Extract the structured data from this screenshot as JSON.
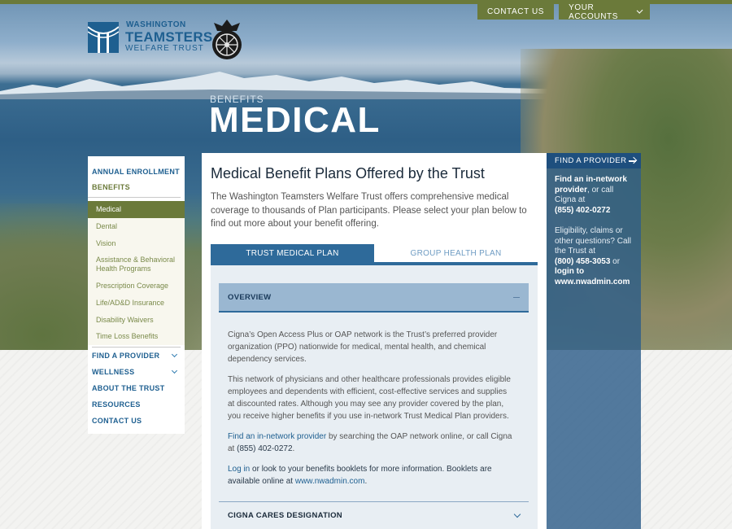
{
  "topnav": {
    "contact": "CONTACT US",
    "accounts": "YOUR ACCOUNTS"
  },
  "logo": {
    "line1": "WASHINGTON",
    "line2": "TEAMSTERS",
    "line3": "WELFARE TRUST"
  },
  "page": {
    "breadcrumb": "BENEFITS",
    "title": "MEDICAL"
  },
  "sidebar": {
    "annual": "ANNUAL ENROLLMENT",
    "benefits": "BENEFITS",
    "sub_items": [
      "Medical",
      "Dental",
      "Vision",
      "Assistance & Behavioral Health Programs",
      "Prescription Coverage",
      "Life/AD&D Insurance",
      "Disability Waivers",
      "Time Loss Benefits"
    ],
    "links": [
      "FIND A PROVIDER",
      "WELLNESS",
      "ABOUT THE TRUST",
      "RESOURCES",
      "CONTACT US"
    ]
  },
  "main": {
    "heading": "Medical Benefit Plans Offered by the Trust",
    "intro": "The Washington Teamsters Welfare Trust offers comprehensive medical coverage to thousands of Plan participants. Please select your plan below to find out more about your benefit offering.",
    "tabs": [
      "TRUST MEDICAL PLAN",
      "GROUP HEALTH PLAN"
    ],
    "accordion": {
      "overview_label": "OVERVIEW",
      "p1": "Cigna’s Open Access Plus or OAP network is the Trust’s preferred provider organization (PPO) nationwide for medical, mental health, and chemical dependency services.",
      "p2": "This network of physicians and other healthcare professionals provides eligible employees and dependents with efficient, cost-effective services and supplies at discounted rates. Although you may see any provider covered by the plan, you receive higher benefits if you use in-network Trust Medical Plan providers.",
      "p3_link": "Find an in-network provider",
      "p3_rest": " by searching the OAP network online, or call Cigna at ",
      "p3_phone": "(855) 402-0272",
      "p3_end": ".",
      "p4_link": "Log in",
      "p4_rest": " or look to your benefits booklets for more information. Booklets are available online at ",
      "p4_url": "www.nwadmin.com",
      "p4_end": ".",
      "next_label": "CIGNA CARES DESIGNATION"
    }
  },
  "right": {
    "header": "FIND A PROVIDER",
    "find_bold": "Find an in-network provider",
    "find_rest": ", or call Cigna at",
    "phone1": "(855) 402-0272",
    "q_text": "Eligibility, claims or other questions? Call the Trust at",
    "phone2": "(800) 458-3053",
    "or_text": " or",
    "login_text": "login to www.nwadmin.com"
  }
}
